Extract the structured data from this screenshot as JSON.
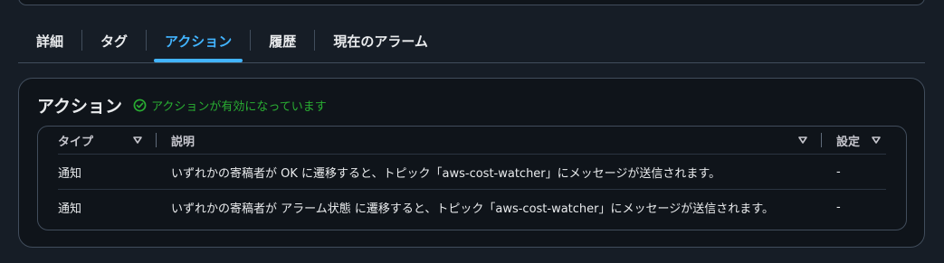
{
  "tabs": [
    {
      "label": "詳細"
    },
    {
      "label": "タグ"
    },
    {
      "label": "アクション"
    },
    {
      "label": "履歴"
    },
    {
      "label": "現在のアラーム"
    }
  ],
  "active_tab_index": 2,
  "panel": {
    "title": "アクション",
    "status_text": "アクションが有効になっています",
    "status_color": "#29ad32"
  },
  "table": {
    "columns": [
      {
        "label": "タイプ"
      },
      {
        "label": "説明"
      },
      {
        "label": "設定"
      }
    ],
    "rows": [
      {
        "type": "通知",
        "description": "いずれかの寄稿者が OK に遷移すると、トピック「aws-cost-watcher」にメッセージが送信されます。",
        "config": "-"
      },
      {
        "type": "通知",
        "description": "いずれかの寄稿者が アラーム状態 に遷移すると、トピック「aws-cost-watcher」にメッセージが送信されます。",
        "config": "-"
      }
    ]
  },
  "colors": {
    "accent": "#42b4ff",
    "background": "#161d26",
    "panel": "#0f141a",
    "border": "#414d5c"
  }
}
